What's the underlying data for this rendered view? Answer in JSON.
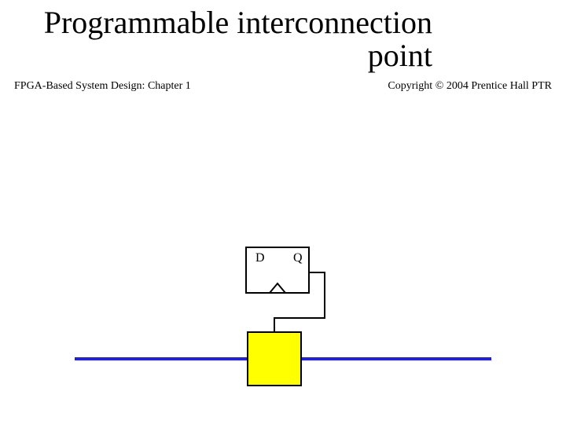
{
  "title_line1": "Programmable interconnection",
  "title_line2": "point",
  "flipflop": {
    "d_label": "D",
    "q_label": "Q"
  },
  "footer": {
    "left": "FPGA-Based System Design: Chapter 1",
    "right": "Copyright © 2004 Prentice Hall PTR"
  },
  "colors": {
    "band": "#1616d6",
    "wire": "#1c1cff",
    "box_stroke": "#000000",
    "switch_fill": "#ffff00"
  },
  "chart_data": {
    "type": "table",
    "description": "Schematic of a programmable interconnection point: a D flip-flop drives the gate of a pass transistor (yellow box) sitting on a horizontal interconnect wire.",
    "elements": [
      {
        "name": "d-flipflop",
        "ports": [
          "D",
          "Q",
          "clk"
        ],
        "shape": "rectangle with clock triangle"
      },
      {
        "name": "pass-transistor",
        "controlled_by": "d-flipflop.Q",
        "on_wire": "interconnect"
      },
      {
        "name": "interconnect",
        "orientation": "horizontal"
      }
    ]
  }
}
